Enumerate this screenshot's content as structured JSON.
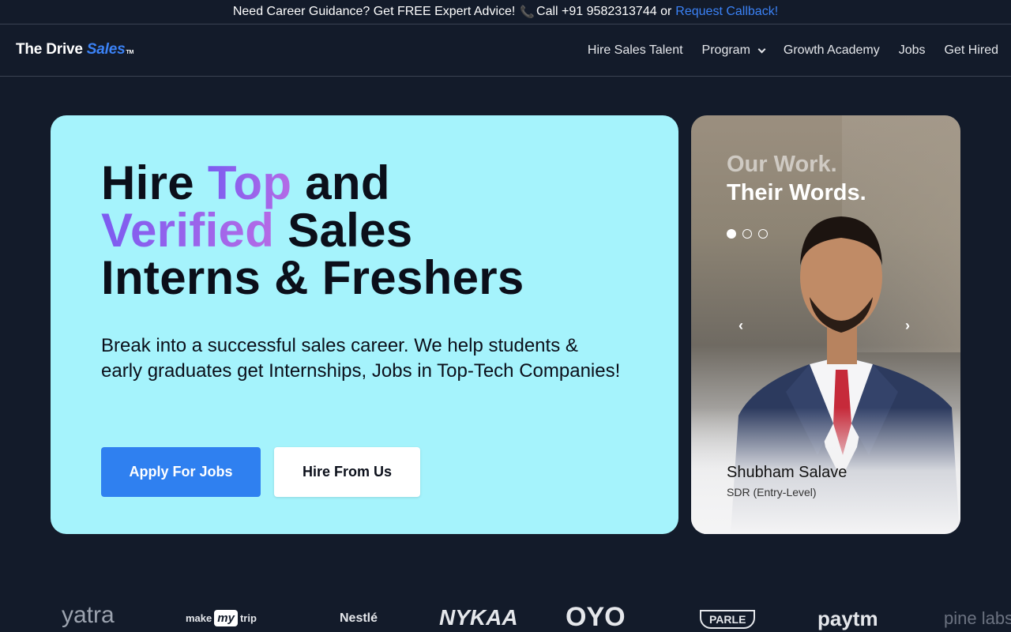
{
  "topbar": {
    "text": "Need Career Guidance? Get FREE Expert Advice!",
    "phone_icon": "phone-icon",
    "call_text": "Call +91 9582313744 or",
    "callback_link": "Request Callback!",
    "link_color": "#3b82f6"
  },
  "nav": {
    "logo_text_1": "The Drive",
    "logo_text_2": "Sales",
    "logo_tm": "TM",
    "items": [
      {
        "label": "Hire Sales Talent"
      },
      {
        "label": "Program",
        "icon": "chevron-down-icon"
      },
      {
        "label": "Growth Academy"
      },
      {
        "label": "Jobs"
      },
      {
        "label": "Get Hired"
      }
    ]
  },
  "hero": {
    "title_1": "Hire ",
    "title_2": "Top",
    "title_3": " and",
    "title_4": "Verified",
    "title_5": " Sales",
    "title_6": "Interns & Freshers",
    "subtitle": "Break into a successful sales career. We help students & early graduates get Internships, Jobs in Top-Tech Companies!",
    "apply_label": "Apply For Jobs",
    "hire_label": "Hire From Us",
    "bg_color": "#a5f3fc",
    "apply_color": "#2f80f0"
  },
  "testimonial": {
    "heading_1": "Our Work.",
    "heading_2": "Their Words.",
    "slide_count": 3,
    "active_slide": 1,
    "name": "Shubham Salave",
    "role": "SDR (Entry-Level)",
    "prev_icon": "chevron-left-icon",
    "next_icon": "chevron-right-icon"
  },
  "logos": {
    "brands": [
      "yatra",
      "make",
      "my",
      "trip",
      "Nestlé",
      "NYKAA",
      "OYO",
      "PARLE",
      "paytm",
      "pine labs"
    ]
  }
}
